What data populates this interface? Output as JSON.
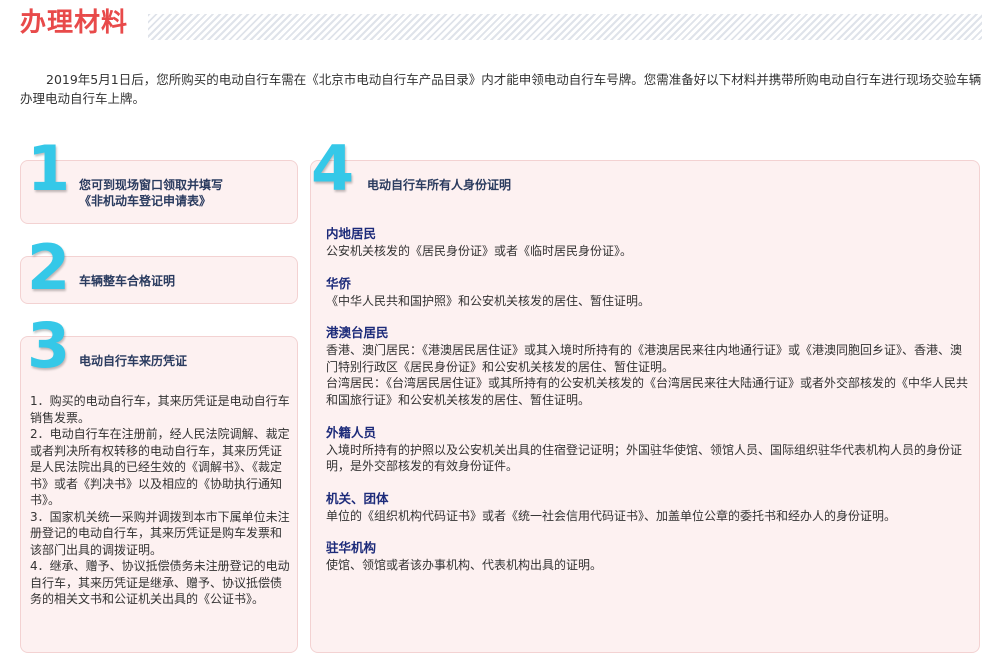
{
  "header": {
    "title": "办理材料"
  },
  "intro": "2019年5月1日后，您所购买的电动自行车需在《北京市电动自行车产品目录》内才能申领电动自行车号牌。您需准备好以下材料并携带所购电动自行车进行现场交验车辆办理电动自行车上牌。",
  "cards": {
    "c1": {
      "number": "1",
      "title_line1": "您可到现场窗口领取并填写",
      "title_line2": "《非机动车登记申请表》"
    },
    "c2": {
      "number": "2",
      "title": "车辆整车合格证明"
    },
    "c3": {
      "number": "3",
      "title": "电动自行车来历凭证",
      "items": [
        "1．购买的电动自行车，其来历凭证是电动自行车销售发票。",
        "2．电动自行车在注册前，经人民法院调解、裁定或者判决所有权转移的电动自行车，其来历凭证是人民法院出具的已经生效的《调解书》、《裁定书》或者《判决书》以及相应的《协助执行通知书》。",
        "3．国家机关统一采购并调拨到本市下属单位未注册登记的电动自行车，其来历凭证是购车发票和该部门出具的调拨证明。",
        "4．继承、赠予、协议抵偿债务未注册登记的电动自行车，其来历凭证是继承、赠予、协议抵偿债务的相关文书和公证机关出具的《公证书》。"
      ]
    },
    "c4": {
      "number": "4",
      "title": "电动自行车所有人身份证明",
      "sections": [
        {
          "title": "内地居民",
          "lines": [
            "公安机关核发的《居民身份证》或者《临时居民身份证》。"
          ]
        },
        {
          "title": "华侨",
          "lines": [
            "《中华人民共和国护照》和公安机关核发的居住、暂住证明。"
          ]
        },
        {
          "title": "港澳台居民",
          "lines": [
            "香港、澳门居民：《港澳居民居住证》或其入境时所持有的《港澳居民来往内地通行证》或《港澳同胞回乡证》、香港、澳门特别行政区《居民身份证》和公安机关核发的居住、暂住证明。",
            "台湾居民：《台湾居民居住证》或其所持有的公安机关核发的《台湾居民来往大陆通行证》或者外交部核发的《中华人民共和国旅行证》和公安机关核发的居住、暂住证明。"
          ]
        },
        {
          "title": "外籍人员",
          "lines": [
            "入境时所持有的护照以及公安机关出具的住宿登记证明；外国驻华使馆、领馆人员、国际组织驻华代表机构人员的身份证明，是外交部核发的有效身份证件。"
          ]
        },
        {
          "title": "机关、团体",
          "lines": [
            "单位的《组织机构代码证书》或者《统一社会信用代码证书》、加盖单位公章的委托书和经办人的身份证明。"
          ]
        },
        {
          "title": "驻华机构",
          "lines": [
            "使馆、领馆或者该办事机构、代表机构出具的证明。"
          ]
        }
      ]
    }
  },
  "colors": {
    "title_red": "#e84a4a",
    "number_cyan": "#35c8e8",
    "section_blue": "#1d2b7a",
    "card_bg": "#fdf1f1"
  }
}
